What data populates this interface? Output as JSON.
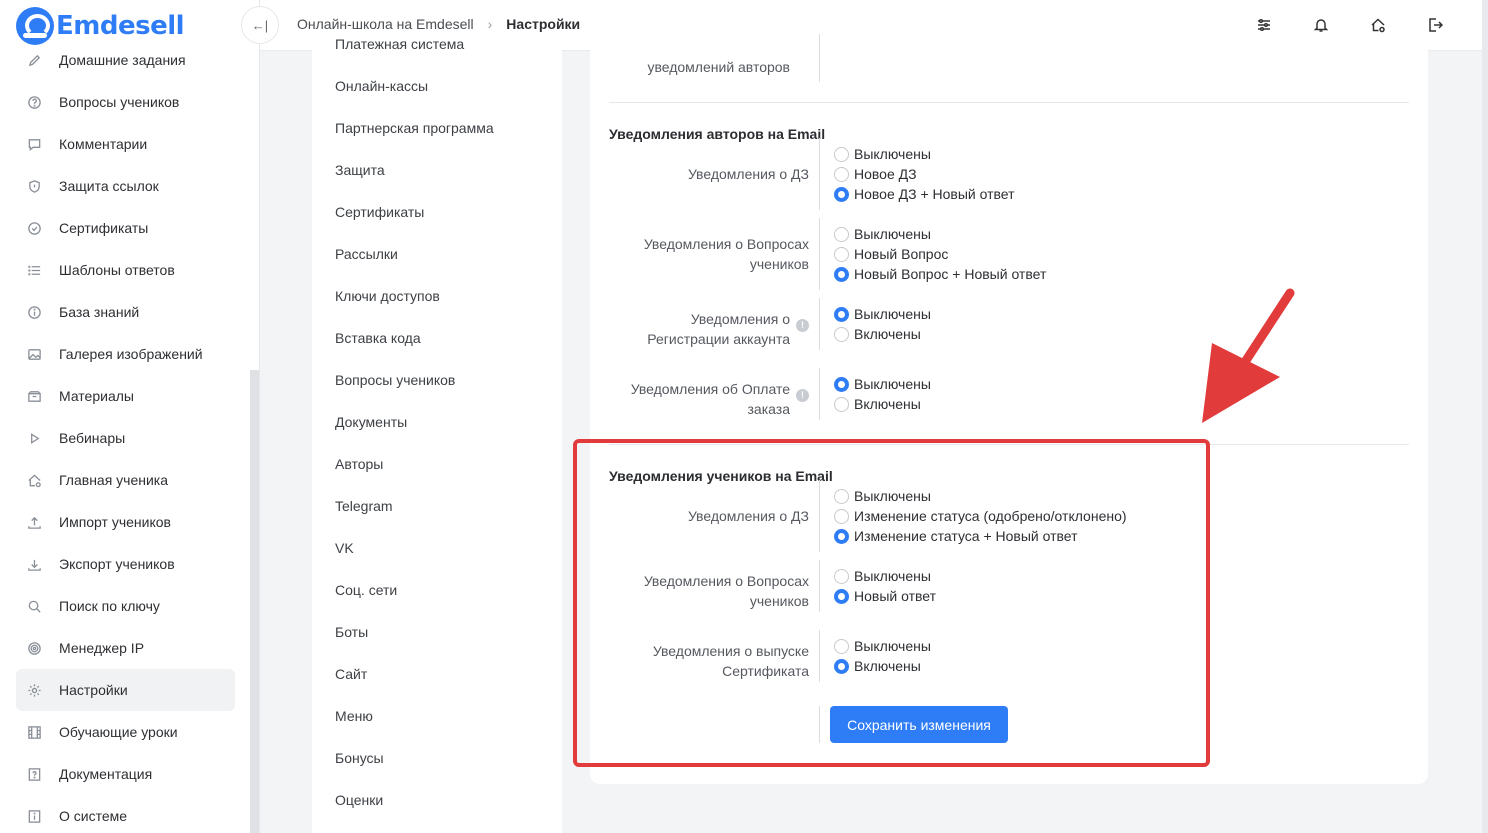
{
  "brand": {
    "name": "Emdesell",
    "color": "#2f7df6"
  },
  "sidebar": {
    "items": [
      {
        "label": "Домашние задания",
        "icon": "pencil-icon"
      },
      {
        "label": "Вопросы учеников",
        "icon": "question-circle-icon"
      },
      {
        "label": "Комментарии",
        "icon": "comment-icon"
      },
      {
        "label": "Защита ссылок",
        "icon": "shield-icon"
      },
      {
        "label": "Сертификаты",
        "icon": "check-badge-icon"
      },
      {
        "label": "Шаблоны ответов",
        "icon": "list-icon"
      },
      {
        "label": "База знаний",
        "icon": "info-circle-icon"
      },
      {
        "label": "Галерея изображений",
        "icon": "image-icon"
      },
      {
        "label": "Материалы",
        "icon": "box-icon"
      },
      {
        "label": "Вебинары",
        "icon": "play-icon"
      },
      {
        "label": "Главная ученика",
        "icon": "home-user-icon"
      },
      {
        "label": "Импорт учеников",
        "icon": "upload-icon"
      },
      {
        "label": "Экспорт учеников",
        "icon": "download-icon"
      },
      {
        "label": "Поиск по ключу",
        "icon": "search-icon"
      },
      {
        "label": "Менеджер IP",
        "icon": "target-icon"
      },
      {
        "label": "Настройки",
        "icon": "gear-icon",
        "active": true
      },
      {
        "label": "Обучающие уроки",
        "icon": "film-icon"
      },
      {
        "label": "Документация",
        "icon": "doc-question-icon"
      },
      {
        "label": "О системе",
        "icon": "info-square-icon"
      }
    ]
  },
  "header": {
    "breadcrumb": [
      "Онлайн-школа на Emdesell",
      "Настройки"
    ],
    "icons": [
      "sliders-icon",
      "bell-icon",
      "home-gear-icon",
      "logout-icon"
    ]
  },
  "submenu": {
    "items": [
      "Платежная система",
      "Онлайн-кассы",
      "Партнерская программа",
      "Защита",
      "Сертификаты",
      "Рассылки",
      "Ключи доступов",
      "Вставка кода",
      "Вопросы учеников",
      "Документы",
      "Авторы",
      "Telegram",
      "VK",
      "Соц. сети",
      "Боты",
      "Сайт",
      "Меню",
      "Бонусы",
      "Оценки"
    ]
  },
  "settings": {
    "top_row_label": "уведомлений авторов",
    "authors": {
      "title": "Уведомления авторов на Email",
      "rows": [
        {
          "label": [
            "Уведомления о ДЗ"
          ],
          "options": [
            "Выключены",
            "Новое ДЗ",
            "Новое ДЗ + Новый ответ"
          ],
          "selected": 2
        },
        {
          "label": [
            "Уведомления о Вопросах",
            "учеников"
          ],
          "options": [
            "Выключены",
            "Новый Вопрос",
            "Новый Вопрос + Новый ответ"
          ],
          "selected": 2
        },
        {
          "label": [
            "Уведомления о",
            "Регистрации аккаунта"
          ],
          "info": true,
          "options": [
            "Выключены",
            "Включены"
          ],
          "selected": 0
        },
        {
          "label": [
            "Уведомления об Оплате",
            "заказа"
          ],
          "info": true,
          "options": [
            "Выключены",
            "Включены"
          ],
          "selected": 0
        }
      ]
    },
    "students": {
      "title": "Уведомления учеников на Email",
      "rows": [
        {
          "label": [
            "Уведомления о ДЗ"
          ],
          "options": [
            "Выключены",
            "Изменение статуса (одобрено/отклонено)",
            "Изменение статуса + Новый ответ"
          ],
          "selected": 2
        },
        {
          "label": [
            "Уведомления о Вопросах",
            "учеников"
          ],
          "options": [
            "Выключены",
            "Новый ответ"
          ],
          "selected": 1
        },
        {
          "label": [
            "Уведомления о выпуске",
            "Сертификата"
          ],
          "options": [
            "Выключены",
            "Включены"
          ],
          "selected": 1
        }
      ]
    },
    "save_label": "Сохранить изменения"
  },
  "annotation": {
    "color": "#e23b3b"
  }
}
